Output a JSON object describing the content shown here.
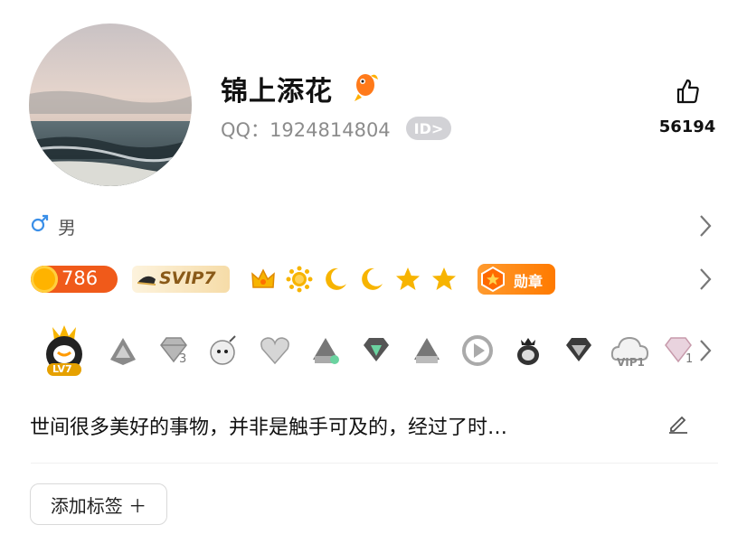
{
  "profile": {
    "nickname": "锦上添花",
    "qq_label": "QQ：",
    "qq_number": "1924814804",
    "id_badge": "ID>",
    "like_count": "56194",
    "gender": "男",
    "signature": "世间很多美好的事物，并非是触手可及的，经过了时…",
    "add_tag_label": "添加标签 ＋"
  },
  "level": {
    "coin_value": "786",
    "svip_label": "SVIP7",
    "icons": [
      "crown-icon",
      "sun-icon",
      "moon-icon",
      "moon-icon",
      "star-icon",
      "star-icon"
    ],
    "medal_label": "勋章"
  },
  "badges": {
    "lv_label": "LV7",
    "sub_labels": [
      "3",
      "VIP1",
      "1"
    ]
  },
  "colors": {
    "accent_orange": "#f05a1a",
    "gold": "#ffb300",
    "gender_blue": "#3a8fe8"
  }
}
